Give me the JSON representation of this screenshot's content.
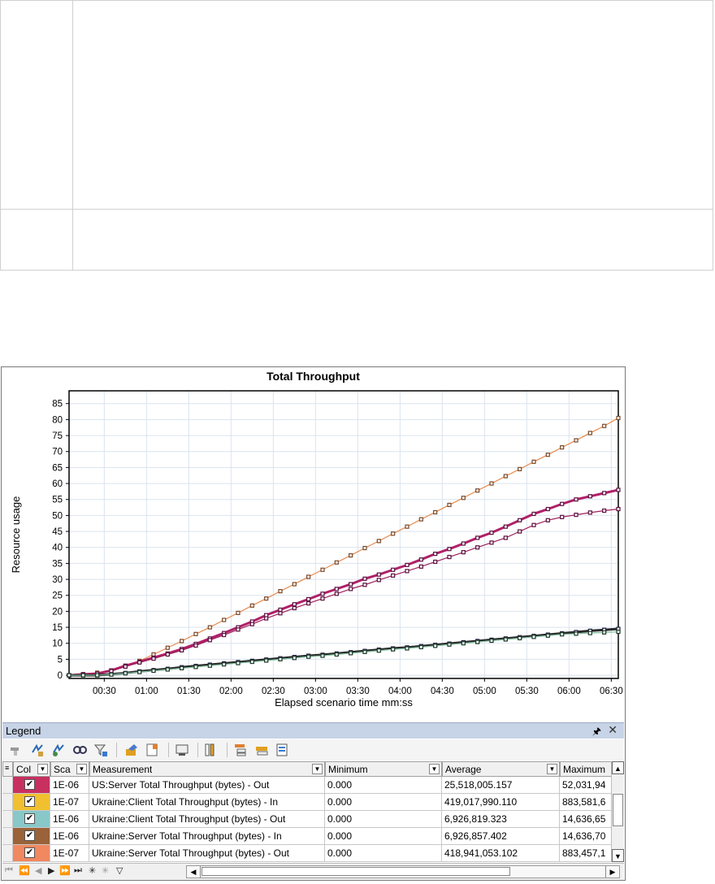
{
  "window": {
    "chart_title": "Total Throughput"
  },
  "chart_data": {
    "type": "line",
    "title": "Total Throughput",
    "xlabel": "Elapsed scenario time mm:ss",
    "ylabel": "Resource usage",
    "x_ticks": [
      "00:30",
      "01:00",
      "01:30",
      "02:00",
      "02:30",
      "03:00",
      "03:30",
      "04:00",
      "04:30",
      "05:00",
      "05:30",
      "06:00",
      "06:30"
    ],
    "y_ticks": [
      0,
      5,
      10,
      15,
      20,
      25,
      30,
      35,
      40,
      45,
      50,
      55,
      60,
      65,
      70,
      75,
      80,
      85
    ],
    "xlim_seconds": [
      5,
      395
    ],
    "ylim": [
      -1,
      89
    ],
    "grid": true,
    "x_seconds": [
      5,
      15,
      25,
      35,
      45,
      55,
      65,
      75,
      85,
      95,
      105,
      115,
      125,
      135,
      145,
      155,
      165,
      175,
      185,
      195,
      205,
      215,
      225,
      235,
      245,
      255,
      265,
      275,
      285,
      295,
      305,
      315,
      325,
      335,
      345,
      355,
      365,
      375,
      385,
      395
    ],
    "series": [
      {
        "color": "#e8894a",
        "marker_color": "#7a4a2a",
        "values": [
          0,
          0.3,
          0.8,
          1.5,
          2.8,
          4.5,
          6.5,
          8.6,
          10.7,
          12.9,
          15.0,
          17.3,
          19.5,
          21.8,
          24.0,
          26.3,
          28.5,
          30.8,
          33.0,
          35.3,
          37.5,
          39.8,
          42.0,
          44.3,
          46.5,
          48.8,
          51.0,
          53.3,
          55.5,
          57.8,
          60.0,
          62.3,
          64.5,
          66.8,
          69.0,
          71.3,
          73.5,
          75.8,
          78.0,
          80.5
        ]
      },
      {
        "color": "#b02068",
        "marker_color": "#5a1040",
        "thick": true,
        "values": [
          0,
          0.3,
          0.5,
          1.5,
          3.0,
          4.2,
          5.5,
          6.8,
          8.2,
          9.8,
          11.5,
          13.2,
          15.0,
          16.8,
          18.8,
          20.5,
          22.2,
          23.8,
          25.5,
          27.0,
          28.5,
          30.2,
          31.5,
          33.0,
          34.5,
          36.2,
          38.0,
          39.5,
          41.2,
          43.0,
          44.6,
          46.5,
          48.5,
          50.5,
          52.0,
          53.6,
          55.0,
          56.0,
          57.0,
          58.0
        ]
      },
      {
        "color": "#a0205a",
        "marker_color": "#5a1040",
        "values": [
          0,
          0.3,
          0.5,
          1.3,
          2.7,
          4.0,
          5.2,
          6.5,
          7.8,
          9.3,
          11.0,
          12.6,
          14.3,
          16.0,
          17.8,
          19.4,
          21.0,
          22.5,
          24.0,
          25.5,
          27.0,
          28.3,
          29.8,
          31.2,
          32.6,
          34.0,
          35.5,
          37.0,
          38.5,
          40.0,
          41.5,
          43.0,
          45.0,
          47.0,
          48.5,
          49.5,
          50.2,
          50.9,
          51.5,
          52.0
        ]
      },
      {
        "color": "#2a2a2a",
        "marker_color": "#1a1a3a",
        "thick": true,
        "values": [
          0,
          0,
          0,
          0.3,
          0.7,
          1.2,
          1.6,
          2.0,
          2.5,
          2.9,
          3.3,
          3.7,
          4.1,
          4.5,
          4.9,
          5.3,
          5.7,
          6.1,
          6.4,
          6.8,
          7.2,
          7.6,
          8.0,
          8.4,
          8.7,
          9.1,
          9.5,
          9.9,
          10.3,
          10.7,
          11.1,
          11.5,
          11.9,
          12.3,
          12.7,
          13.1,
          13.5,
          13.9,
          14.2,
          14.5
        ]
      },
      {
        "color": "#7fbf9f",
        "marker_color": "#1a3a2a",
        "values": [
          0,
          0,
          0,
          0.2,
          0.6,
          1.0,
          1.4,
          1.8,
          2.2,
          2.6,
          3.0,
          3.4,
          3.8,
          4.2,
          4.6,
          5.0,
          5.4,
          5.8,
          6.1,
          6.5,
          6.9,
          7.3,
          7.7,
          8.1,
          8.4,
          8.8,
          9.2,
          9.6,
          10.0,
          10.4,
          10.8,
          11.2,
          11.6,
          12.0,
          12.4,
          12.8,
          13.0,
          13.2,
          13.4,
          13.6
        ]
      }
    ]
  },
  "legend": {
    "title": "Legend",
    "columns": {
      "col": "Col",
      "scale": "Sca",
      "measurement": "Measurement",
      "minimum": "Minimum",
      "average": "Average",
      "maximum": "Maximum"
    },
    "rows": [
      {
        "color": "#c83060",
        "checked": "✔",
        "scale": "1E-06",
        "measurement": "US:Server Total Throughput (bytes) - Out",
        "minimum": "0.000",
        "average": "25,518,005.157",
        "maximum": "52,031,94"
      },
      {
        "color": "#f0c030",
        "checked": "✔",
        "scale": "1E-07",
        "measurement": "Ukraine:Client Total Throughput (bytes) - In",
        "minimum": "0.000",
        "average": "419,017,990.110",
        "maximum": "883,581,6"
      },
      {
        "color": "#88c8c8",
        "checked": "✔",
        "scale": "1E-06",
        "measurement": "Ukraine:Client Total Throughput (bytes) - Out",
        "minimum": "0.000",
        "average": "6,926,819.323",
        "maximum": "14,636,65"
      },
      {
        "color": "#9a6238",
        "checked": "✔",
        "scale": "1E-06",
        "measurement": "Ukraine:Server Total Throughput (bytes) - In",
        "minimum": "0.000",
        "average": "6,926,857.402",
        "maximum": "14,636,70"
      },
      {
        "color": "#f08860",
        "checked": "✔",
        "scale": "1E-07",
        "measurement": "Ukraine:Server Total Throughput (bytes) - Out",
        "minimum": "0.000",
        "average": "418,941,053.102",
        "maximum": "883,457,1"
      }
    ]
  },
  "icons": {
    "pin": "pin-icon",
    "close": "close-icon"
  }
}
